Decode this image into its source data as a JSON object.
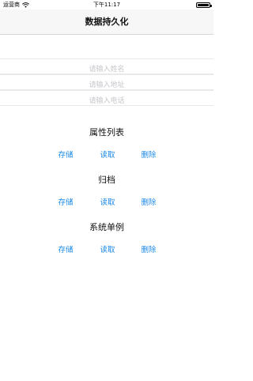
{
  "status": {
    "carrier": "运营商",
    "time": "下午11:17"
  },
  "nav": {
    "title": "数据持久化"
  },
  "inputs": [
    {
      "placeholder": "请输入姓名",
      "value": ""
    },
    {
      "placeholder": "请输入地址",
      "value": ""
    },
    {
      "placeholder": "请输入电话",
      "value": ""
    }
  ],
  "sections": [
    {
      "title": "属性列表",
      "save": "存储",
      "read": "读取",
      "delete": "删除"
    },
    {
      "title": "归档",
      "save": "存储",
      "read": "读取",
      "delete": "删除"
    },
    {
      "title": "系统单例",
      "save": "存储",
      "read": "读取",
      "delete": "删除"
    }
  ],
  "colors": {
    "accent": "#1e8ae6",
    "nav_bg": "#f7f7f7",
    "placeholder": "#c7c7cd"
  }
}
